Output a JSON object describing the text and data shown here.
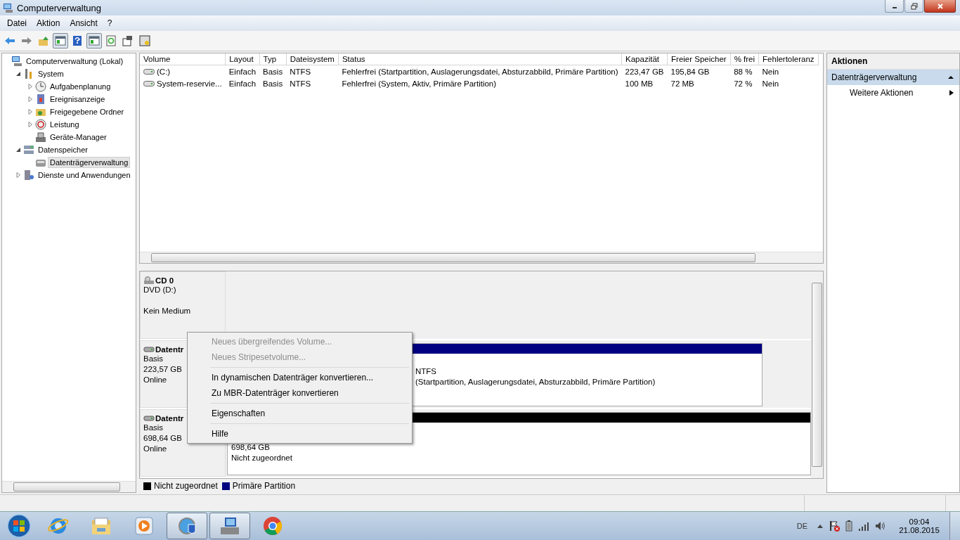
{
  "window": {
    "title": "Computerverwaltung"
  },
  "menu": [
    "Datei",
    "Aktion",
    "Ansicht",
    "?"
  ],
  "toolbar": [
    {
      "pressed": false
    },
    {
      "pressed": false
    },
    {
      "pressed": false
    },
    {
      "pressed": true
    },
    {
      "pressed": false
    },
    {
      "pressed": true
    },
    {
      "pressed": false
    },
    {
      "pressed": false
    },
    {
      "pressed": false
    }
  ],
  "tree": [
    {
      "label": "Computerverwaltung (Lokal)",
      "selected": false,
      "children": [
        {
          "label": "System",
          "selected": false,
          "expanded": true,
          "children": [
            {
              "label": "Aufgabenplanung",
              "selected": false,
              "expanded": false
            },
            {
              "label": "Ereignisanzeige",
              "selected": false,
              "expanded": false
            },
            {
              "label": "Freigegebene Ordner",
              "selected": false,
              "expanded": false
            },
            {
              "label": "Leistung",
              "selected": false,
              "expanded": false
            },
            {
              "label": "Geräte-Manager",
              "selected": false
            }
          ]
        },
        {
          "label": "Datenspeicher",
          "selected": false,
          "expanded": true,
          "children": [
            {
              "label": "Datenträgerverwaltung",
              "selected": true
            }
          ]
        },
        {
          "label": "Dienste und Anwendungen",
          "selected": false,
          "expanded": false
        }
      ]
    }
  ],
  "table": {
    "columns": [
      "Volume",
      "Layout",
      "Typ",
      "Dateisystem",
      "Status",
      "Kapazität",
      "Freier Speicher",
      "% frei",
      "Fehlertoleranz"
    ],
    "rows": [
      [
        "(C:)",
        "Einfach",
        "Basis",
        "NTFS",
        "Fehlerfrei (Startpartition, Auslagerungsdatei, Absturzabbild, Primäre Partition)",
        "223,47 GB",
        "195,84 GB",
        "88 %",
        "Nein"
      ],
      [
        "System-reservie...",
        "Einfach",
        "Basis",
        "NTFS",
        "Fehlerfrei (System, Aktiv, Primäre Partition)",
        "100 MB",
        "72 MB",
        "72 %",
        "Nein"
      ]
    ]
  },
  "disks": [
    {
      "kind": "cdrom",
      "name": "CD 0",
      "lines": [
        "DVD (D:)"
      ],
      "status": "Kein Medium"
    },
    {
      "kind": "disk",
      "name": "Datentr",
      "lines": [
        "Basis",
        "223,57 GB",
        "Online"
      ],
      "partitions": [
        {
          "color": "#000080",
          "lines": [
            "NTFS",
            "(Startpartition, Auslagerungsdatei, Absturzabbild, Primäre Partition)"
          ]
        }
      ]
    },
    {
      "kind": "disk",
      "name": "Datentr",
      "lines": [
        "Basis",
        "698,64 GB",
        "Online"
      ],
      "partitions": [
        {
          "color": "#000000",
          "lines": [
            "698,64 GB",
            "Nicht zugeordnet"
          ]
        }
      ]
    }
  ],
  "legend": [
    {
      "label": "Nicht zugeordnet",
      "color": "#000000"
    },
    {
      "label": "Primäre Partition",
      "color": "#000080"
    }
  ],
  "actions": {
    "title": "Aktionen",
    "section": "Datenträgerverwaltung",
    "expanded": true,
    "items": [
      "Weitere Aktionen"
    ]
  },
  "context_menu": [
    {
      "label": "Neues übergreifendes Volume...",
      "disabled": true
    },
    {
      "label": "Neues Stripesetvolume...",
      "disabled": true,
      "separator_after": true
    },
    {
      "label": "In dynamischen Datenträger konvertieren...",
      "disabled": false
    },
    {
      "label": "Zu MBR-Datenträger konvertieren",
      "disabled": false,
      "separator_after": true
    },
    {
      "label": "Eigenschaften",
      "disabled": false,
      "separator_after": true
    },
    {
      "label": "Hilfe",
      "disabled": false
    }
  ],
  "taskbar": {
    "apps": [
      {
        "open": false
      },
      {
        "open": false
      },
      {
        "open": false
      },
      {
        "open": true
      },
      {
        "open": true
      },
      {
        "open": false
      }
    ],
    "language": "DE",
    "time": "09:04",
    "date": "21.08.2015"
  }
}
